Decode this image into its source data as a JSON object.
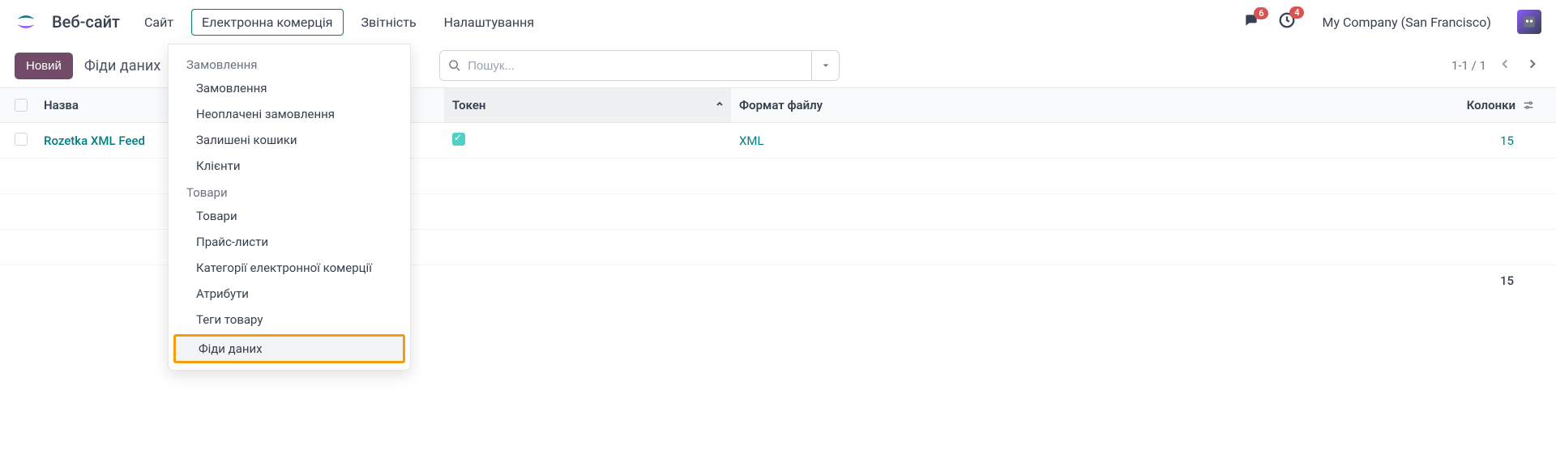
{
  "brand": "Веб-сайт",
  "nav": [
    "Сайт",
    "Електронна комерція",
    "Звітність",
    "Налаштування"
  ],
  "badges": {
    "chat": "6",
    "activity": "4"
  },
  "company": "My Company (San Francisco)",
  "btn_new": "Новий",
  "breadcrumb": "Фіди даних",
  "search": {
    "placeholder": "Пошук..."
  },
  "pager": "1-1 / 1",
  "columns": {
    "name": "Назва",
    "token": "Токен",
    "format": "Формат файлу",
    "cols": "Колонки"
  },
  "rows": [
    {
      "name": "Rozetka XML Feed",
      "token_checked": true,
      "format": "XML",
      "cols": "15"
    }
  ],
  "footer_total": "15",
  "dropdown": {
    "sections": [
      {
        "title": "Замовлення",
        "items": [
          "Замовлення",
          "Неоплачені замовлення",
          "Залишені кошики",
          "Клієнти"
        ]
      },
      {
        "title": "Товари",
        "items": [
          "Товари",
          "Прайс-листи",
          "Категорії електронної комерції",
          "Атрибути",
          "Теги товару",
          "Фіди даних"
        ]
      }
    ]
  }
}
